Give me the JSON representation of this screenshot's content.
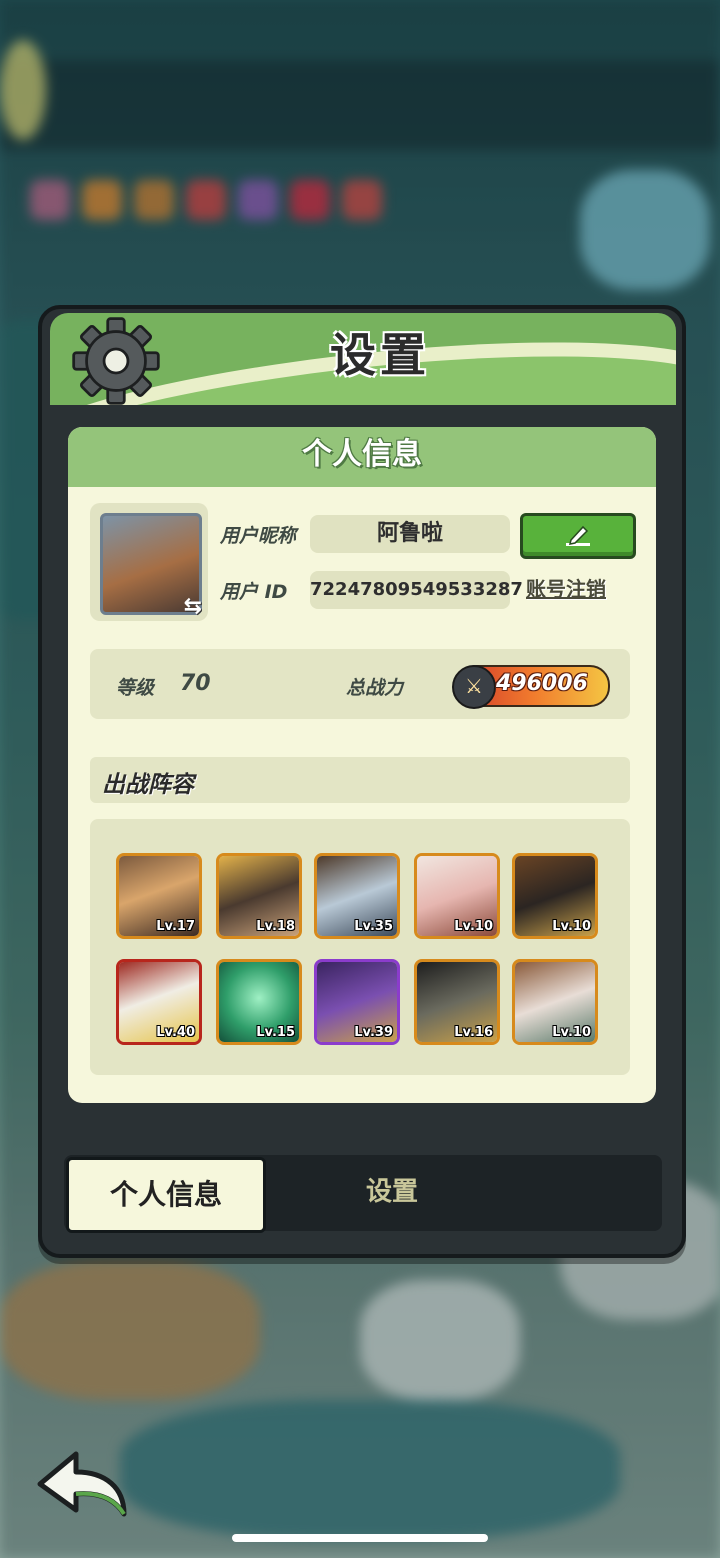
{
  "panel": {
    "title": "设置",
    "card_title": "个人信息",
    "profile": {
      "nickname_label": "用户昵称",
      "nickname": "阿鲁啦",
      "user_id_label": "用户  ID",
      "user_id": "72247809549533287",
      "logout_label": "账号注销",
      "swap_icon": "⇆"
    },
    "stats": {
      "level_label": "等级",
      "level": "70",
      "power_label": "总战力",
      "power": "496006"
    },
    "lineup": {
      "title": "出战阵容",
      "heroes": [
        {
          "level": "Lv.17"
        },
        {
          "level": "Lv.18"
        },
        {
          "level": "Lv.35"
        },
        {
          "level": "Lv.10"
        },
        {
          "level": "Lv.10"
        },
        {
          "level": "Lv.40"
        },
        {
          "level": "Lv.15"
        },
        {
          "level": "Lv.39"
        },
        {
          "level": "Lv.16"
        },
        {
          "level": "Lv.10"
        }
      ]
    },
    "tabs": {
      "personal": "个人信息",
      "settings": "设置"
    }
  },
  "colors": {
    "header_green": "#77b25e",
    "card_bg": "#f6f7dc",
    "edit_green": "#58b23b",
    "gold_border": "#d78a1c",
    "red_border": "#b8261c",
    "purple_border": "#8b3ccc"
  }
}
